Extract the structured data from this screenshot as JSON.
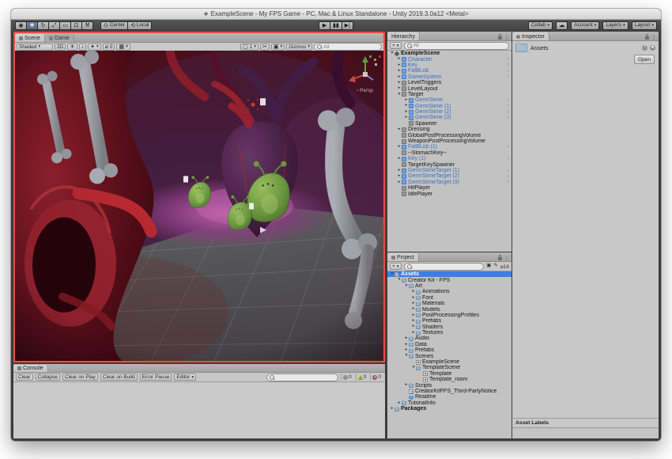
{
  "window": {
    "title": "ExampleScene - My FPS Game - PC, Mac & Linux Standalone - Unity 2019.3.0a12 <Metal>"
  },
  "toolbar": {
    "tools": [
      "hand-tool",
      "move-tool",
      "rotate-tool",
      "scale-tool",
      "rect-tool",
      "transform-tool",
      "custom-tool"
    ],
    "pivot": "Center",
    "space": "Local",
    "collab": "Collab",
    "account": "Account",
    "layers": "Layers",
    "layout": "Layout"
  },
  "scene": {
    "tab_scene": "Scene",
    "tab_game": "Game",
    "draw_mode": "Shaded",
    "mode_2d": "2D",
    "hidden_count": "0",
    "vis_count": "1",
    "gizmos": "Gizmos",
    "search_placeholder": "All",
    "persp": "Persp"
  },
  "console": {
    "tab": "Console",
    "clear": "Clear",
    "collapse": "Collapse",
    "clear_on_play": "Clear on Play",
    "clear_on_build": "Clear on Build",
    "error_pause": "Error Pause",
    "editor": "Editor",
    "info_count": "0",
    "warn_count": "0",
    "error_count": "0"
  },
  "hierarchy": {
    "tab": "Hierarchy",
    "search_placeholder": "All",
    "items": [
      {
        "label": "ExampleScene",
        "depth": 0,
        "tw": "expanded",
        "icon": "scene",
        "lb": "root",
        "chev": ""
      },
      {
        "label": "Character",
        "depth": 1,
        "tw": "collapsed",
        "icon": "prefab",
        "lb": "prefab-label",
        "chev": "yes"
      },
      {
        "label": "Key",
        "depth": 1,
        "tw": "collapsed",
        "icon": "prefab",
        "lb": "prefab-label",
        "chev": "yes"
      },
      {
        "label": "FatBLob",
        "depth": 1,
        "tw": "collapsed",
        "icon": "prefab",
        "lb": "prefab-label",
        "chev": "yes"
      },
      {
        "label": "GameSystem",
        "depth": 1,
        "tw": "collapsed",
        "icon": "prefab",
        "lb": "prefab-label",
        "chev": "yes"
      },
      {
        "label": "LevelTriggers",
        "depth": 1,
        "tw": "collapsed",
        "icon": "go",
        "lb": "plain",
        "chev": ""
      },
      {
        "label": "LevelLayout",
        "depth": 1,
        "tw": "collapsed",
        "icon": "go",
        "lb": "plain",
        "chev": ""
      },
      {
        "label": "Target",
        "depth": 1,
        "tw": "expanded",
        "icon": "go",
        "lb": "plain",
        "chev": ""
      },
      {
        "label": "GermSlime",
        "depth": 2,
        "tw": "collapsed",
        "icon": "prefab",
        "lb": "prefab-label",
        "chev": "yes"
      },
      {
        "label": "GermSlime (1)",
        "depth": 2,
        "tw": "collapsed",
        "icon": "prefab",
        "lb": "prefab-label",
        "chev": "yes"
      },
      {
        "label": "GermSlime (2)",
        "depth": 2,
        "tw": "collapsed",
        "icon": "prefab",
        "lb": "prefab-label",
        "chev": "yes"
      },
      {
        "label": "GermSlime (3)",
        "depth": 2,
        "tw": "collapsed",
        "icon": "prefab",
        "lb": "prefab-label",
        "chev": "yes"
      },
      {
        "label": "Spawner",
        "depth": 2,
        "tw": "leaf",
        "icon": "go",
        "lb": "plain",
        "chev": ""
      },
      {
        "label": "Dressing",
        "depth": 1,
        "tw": "collapsed",
        "icon": "go",
        "lb": "plain",
        "chev": ""
      },
      {
        "label": "GlobalPostProcessingVolume",
        "depth": 1,
        "tw": "leaf",
        "icon": "go",
        "lb": "plain",
        "chev": ""
      },
      {
        "label": "WeaponPostProcessingVolume",
        "depth": 1,
        "tw": "leaf",
        "icon": "go",
        "lb": "plain",
        "chev": ""
      },
      {
        "label": "FatBLob (1)",
        "depth": 1,
        "tw": "collapsed",
        "icon": "prefab",
        "lb": "prefab-label",
        "chev": "yes"
      },
      {
        "label": "--StomachKey--",
        "depth": 1,
        "tw": "leaf",
        "icon": "go",
        "lb": "plain",
        "chev": ""
      },
      {
        "label": "Key (1)",
        "depth": 1,
        "tw": "collapsed",
        "icon": "prefab",
        "lb": "prefab-label",
        "chev": "yes"
      },
      {
        "label": "TargetKeySpawner",
        "depth": 1,
        "tw": "leaf",
        "icon": "go",
        "lb": "plain",
        "chev": ""
      },
      {
        "label": "GermSlimeTarget (1)",
        "depth": 1,
        "tw": "collapsed",
        "icon": "prefab",
        "lb": "prefab-label",
        "chev": "yes"
      },
      {
        "label": "GermSlimeTarget (2)",
        "depth": 1,
        "tw": "collapsed",
        "icon": "prefab",
        "lb": "prefab-label",
        "chev": "yes"
      },
      {
        "label": "GermSlimeTarget (3)",
        "depth": 1,
        "tw": "collapsed",
        "icon": "prefab",
        "lb": "prefab-label",
        "chev": "yes"
      },
      {
        "label": "HitPlayer",
        "depth": 1,
        "tw": "leaf",
        "icon": "go",
        "lb": "plain",
        "chev": ""
      },
      {
        "label": "IdlePlayer",
        "depth": 1,
        "tw": "leaf",
        "icon": "go",
        "lb": "plain",
        "chev": ""
      }
    ]
  },
  "project": {
    "tab": "Project",
    "hidden_count": "16",
    "items": [
      {
        "label": "Assets",
        "depth": 0,
        "tw": "expanded",
        "icon": "folder",
        "lb": "bold",
        "state": "sel"
      },
      {
        "label": "Creator Kit - FPS",
        "depth": 1,
        "tw": "expanded",
        "icon": "folder",
        "lb": "plain",
        "state": ""
      },
      {
        "label": "Art",
        "depth": 2,
        "tw": "expanded",
        "icon": "folder",
        "lb": "plain",
        "state": ""
      },
      {
        "label": "Animations",
        "depth": 3,
        "tw": "collapsed",
        "icon": "folder",
        "lb": "plain",
        "state": ""
      },
      {
        "label": "Font",
        "depth": 3,
        "tw": "collapsed",
        "icon": "folder",
        "lb": "plain",
        "state": ""
      },
      {
        "label": "Materials",
        "depth": 3,
        "tw": "collapsed",
        "icon": "folder",
        "lb": "plain",
        "state": ""
      },
      {
        "label": "Models",
        "depth": 3,
        "tw": "collapsed",
        "icon": "folder",
        "lb": "plain",
        "state": ""
      },
      {
        "label": "PostProcessingProfiles",
        "depth": 3,
        "tw": "collapsed",
        "icon": "folder",
        "lb": "plain",
        "state": ""
      },
      {
        "label": "Prefabs",
        "depth": 3,
        "tw": "collapsed",
        "icon": "folder",
        "lb": "plain",
        "state": ""
      },
      {
        "label": "Shaders",
        "depth": 3,
        "tw": "collapsed",
        "icon": "folder",
        "lb": "plain",
        "state": ""
      },
      {
        "label": "Textures",
        "depth": 3,
        "tw": "collapsed",
        "icon": "folder",
        "lb": "plain",
        "state": ""
      },
      {
        "label": "Audio",
        "depth": 2,
        "tw": "collapsed",
        "icon": "folder",
        "lb": "plain",
        "state": ""
      },
      {
        "label": "Data",
        "depth": 2,
        "tw": "collapsed",
        "icon": "folder",
        "lb": "plain",
        "state": ""
      },
      {
        "label": "Prefabs",
        "depth": 2,
        "tw": "collapsed",
        "icon": "folder",
        "lb": "plain",
        "state": ""
      },
      {
        "label": "Scenes",
        "depth": 2,
        "tw": "expanded",
        "icon": "folder",
        "lb": "plain",
        "state": ""
      },
      {
        "label": "ExampleScene",
        "depth": 3,
        "tw": "leaf",
        "icon": "sceneasset",
        "lb": "plain",
        "state": ""
      },
      {
        "label": "TemplateScene",
        "depth": 3,
        "tw": "expanded",
        "icon": "folder",
        "lb": "plain",
        "state": ""
      },
      {
        "label": "Template",
        "depth": 4,
        "tw": "leaf",
        "icon": "sceneasset",
        "lb": "plain",
        "state": ""
      },
      {
        "label": "Template_room",
        "depth": 4,
        "tw": "leaf",
        "icon": "sceneasset",
        "lb": "plain",
        "state": ""
      },
      {
        "label": "Scripts",
        "depth": 2,
        "tw": "collapsed",
        "icon": "folder",
        "lb": "plain",
        "state": ""
      },
      {
        "label": "CreatorKitFPS_Third-PartyNotice",
        "depth": 2,
        "tw": "leaf",
        "icon": "textasset",
        "lb": "plain",
        "state": ""
      },
      {
        "label": "Readme",
        "depth": 2,
        "tw": "leaf",
        "icon": "readme",
        "lb": "plain",
        "state": ""
      },
      {
        "label": "TutorialInfo",
        "depth": 1,
        "tw": "collapsed",
        "icon": "folder",
        "lb": "plain",
        "state": ""
      },
      {
        "label": "Packages",
        "depth": 0,
        "tw": "collapsed",
        "icon": "folder",
        "lb": "bold",
        "state": ""
      }
    ]
  },
  "inspector": {
    "tab": "Inspector",
    "asset_name": "Assets",
    "open": "Open",
    "asset_labels": "Asset Labels"
  },
  "palette": {
    "selection": "#3D7DE4",
    "scene_border": "#F04B40",
    "prefab_text": "#3A6FC4",
    "slime_green": "#7FAE4A",
    "flesh_red": "#8E2030"
  }
}
